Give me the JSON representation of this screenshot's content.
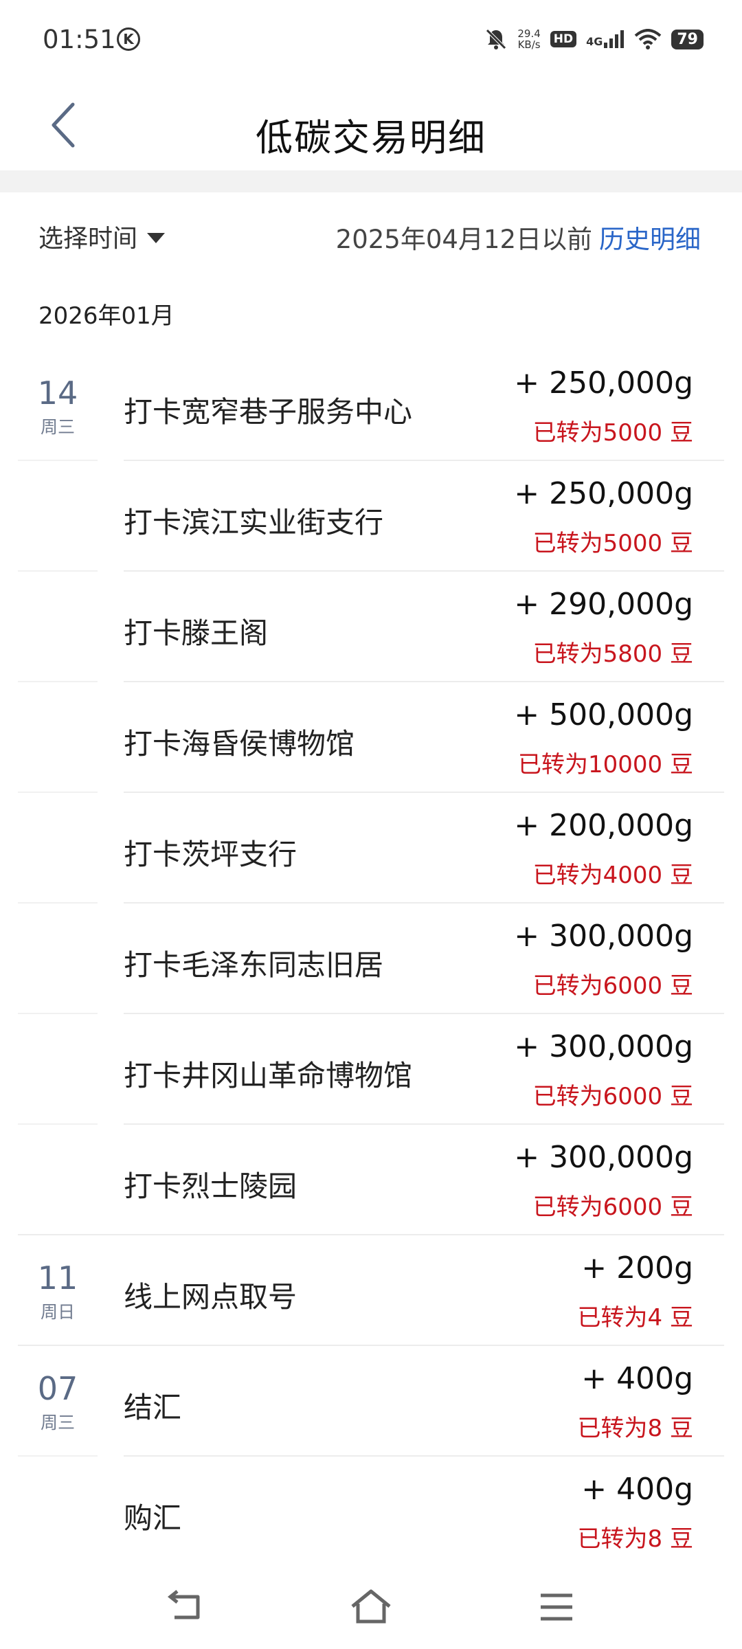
{
  "status": {
    "time": "01:51",
    "k_badge": "K",
    "net_speed_value": "29.4",
    "net_speed_unit": "KB/s",
    "hd": "HD",
    "network": "4G",
    "battery": "79"
  },
  "header": {
    "title": "低碳交易明细"
  },
  "filter": {
    "select_label": "选择时间",
    "before_text": "2025年04月12日以前",
    "history_link": "历史明细"
  },
  "month": "2026年01月",
  "transactions": [
    {
      "day": "14",
      "weekday": "周三",
      "title": "打卡宽窄巷子服务中心",
      "amount": "+ 250,000g",
      "beans": "已转为5000 豆"
    },
    {
      "day": "",
      "weekday": "",
      "title": "打卡滨江实业街支行",
      "amount": "+ 250,000g",
      "beans": "已转为5000 豆"
    },
    {
      "day": "",
      "weekday": "",
      "title": "打卡滕王阁",
      "amount": "+ 290,000g",
      "beans": "已转为5800 豆"
    },
    {
      "day": "",
      "weekday": "",
      "title": "打卡海昏侯博物馆",
      "amount": "+ 500,000g",
      "beans": "已转为10000 豆"
    },
    {
      "day": "",
      "weekday": "",
      "title": "打卡茨坪支行",
      "amount": "+ 200,000g",
      "beans": "已转为4000 豆"
    },
    {
      "day": "",
      "weekday": "",
      "title": "打卡毛泽东同志旧居",
      "amount": "+ 300,000g",
      "beans": "已转为6000 豆"
    },
    {
      "day": "",
      "weekday": "",
      "title": "打卡井冈山革命博物馆",
      "amount": "+ 300,000g",
      "beans": "已转为6000 豆"
    },
    {
      "day": "",
      "weekday": "",
      "title": "打卡烈士陵园",
      "amount": "+ 300,000g",
      "beans": "已转为6000 豆"
    },
    {
      "day": "11",
      "weekday": "周日",
      "title": "线上网点取号",
      "amount": "+ 200g",
      "beans": "已转为4 豆"
    },
    {
      "day": "07",
      "weekday": "周三",
      "title": "结汇",
      "amount": "+ 400g",
      "beans": "已转为8 豆"
    },
    {
      "day": "",
      "weekday": "",
      "title": "购汇",
      "amount": "+ 400g",
      "beans": "已转为8 豆"
    }
  ],
  "colors": {
    "accent_link": "#2a66c8",
    "beans_red": "#c8151d",
    "date_blue_gray": "#5a6a85"
  },
  "nav": {
    "back_icon": "back-nav-icon",
    "home_icon": "home-icon",
    "menu_icon": "menu-icon"
  }
}
